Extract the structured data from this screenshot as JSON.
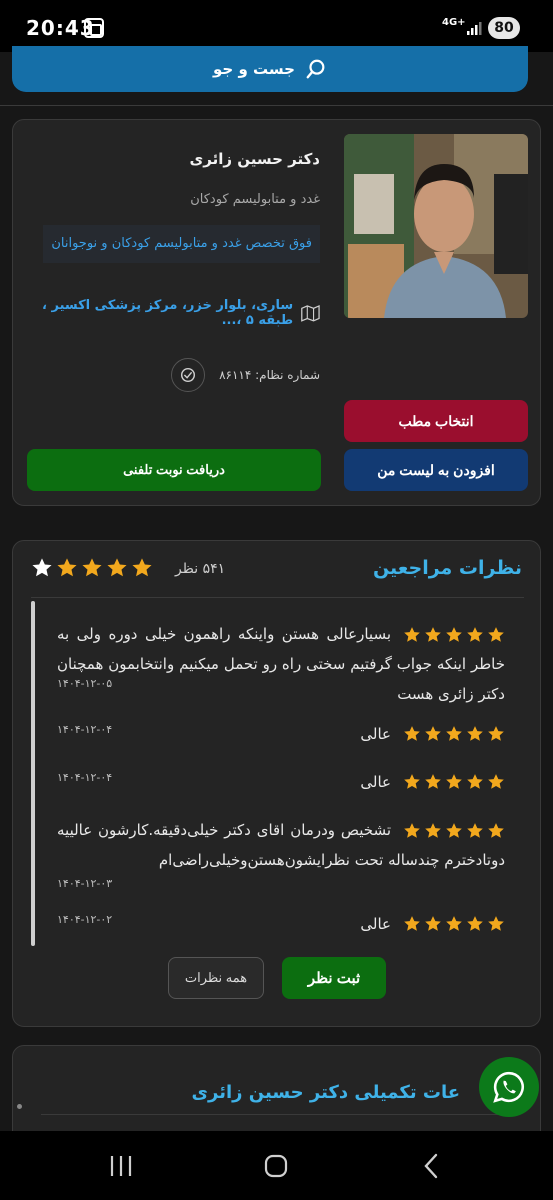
{
  "status": {
    "time": "20:43",
    "network": "4G+",
    "battery": "80"
  },
  "search": {
    "label": "جست و جو"
  },
  "doctor": {
    "name": "دکتر حسین زائری",
    "specialty": "غدد و متابولیسم کودکان",
    "subspecialty": "فوق تخصص غدد و متابولیسم کودکان و نوجوانان",
    "address": "ساری، بلوار خزر، مرکز پزشکی اکسیر ، طبقه ۵ ،...",
    "registration": "شماره نظام: ۸۶۱۱۴"
  },
  "actions": {
    "select_clinic": "انتخاب مطب",
    "add_to_list": "افزودن به لیست من",
    "phone_appointment": "دریافت نوبت تلفنی"
  },
  "reviews_section": {
    "title": "نظرات مراجعین",
    "count": "۵۴۱ نظر",
    "rating_stars": 4,
    "rating_max": 5,
    "colors": {
      "star_filled": "#f2a81d",
      "star_empty": "#ffffff",
      "accent": "#3fb2e8"
    },
    "items": [
      {
        "text": "بسیارعالی هستن واینکه راهمون خیلی دوره ولی به خاطر اینکه جواب گرفتیم سختی راه رو تحمل میکنیم وانتخابمون همچنان دکتر زائری هست",
        "date": "۱۴۰۴-۱۲-۰۵",
        "stars": 5
      },
      {
        "text": "عالی",
        "date": "۱۴۰۴-۱۲-۰۴",
        "stars": 5
      },
      {
        "text": "عالی",
        "date": "۱۴۰۴-۱۲-۰۴",
        "stars": 5
      },
      {
        "text": "تشخیص ودرمان اقای دکتر خیلی‌دقیقه.کارشون عالییه دوتادختر‌م چندساله تحت نظرایشون‌هستن‌وخیلی‌راضی‌ام",
        "date": "۱۴۰۴-۱۲-۰۳",
        "stars": 5
      },
      {
        "text": "عالی",
        "date": "۱۴۰۴-۱۲-۰۲",
        "stars": 5
      }
    ],
    "submit_label": "ثبت نظر",
    "all_label": "همه نظرات"
  },
  "extra_section": {
    "title": "عات تکمیلی دکتر حسین زائری"
  },
  "icons": {
    "search": "search-icon",
    "map": "map-icon",
    "registration": "badge-icon",
    "whatsapp": "whatsapp-icon"
  }
}
